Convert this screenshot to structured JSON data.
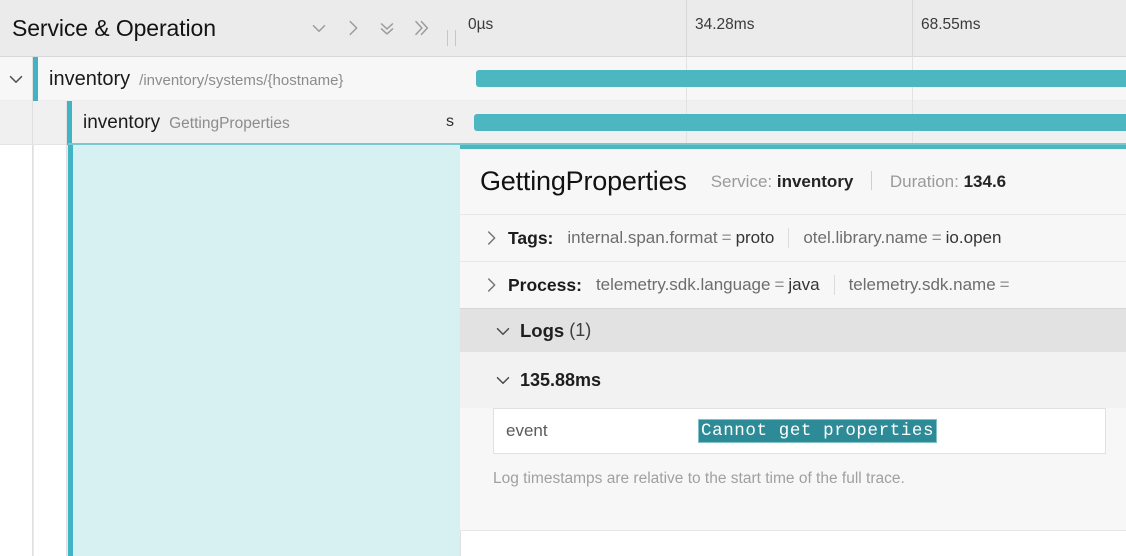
{
  "header": {
    "title": "Service & Operation",
    "icons": [
      {
        "name": "chevron-down-icon"
      },
      {
        "name": "chevron-right-icon"
      },
      {
        "name": "double-chevron-down-icon"
      },
      {
        "name": "double-chevron-right-icon"
      }
    ],
    "ticks": [
      "0µs",
      "34.28ms",
      "68.55ms"
    ]
  },
  "spans": [
    {
      "service": "inventory",
      "operation": "/inventory/systems/{hostname}",
      "expanded": true,
      "bar": {
        "left_pct": 2.4,
        "width_pct": 100
      },
      "duration_clipped": ""
    },
    {
      "service": "inventory",
      "operation": "GettingProperties",
      "expanded": false,
      "bar": {
        "left_pct": 4.7,
        "width_pct": 100
      },
      "duration_clipped": "s"
    }
  ],
  "detail": {
    "title": "GettingProperties",
    "service_label": "Service:",
    "service_value": "inventory",
    "duration_label": "Duration:",
    "duration_value": "134.6",
    "tags": {
      "label": "Tags:",
      "items": [
        {
          "key": "internal.span.format",
          "value": "proto"
        },
        {
          "key": "otel.library.name",
          "value": "io.open"
        }
      ]
    },
    "process": {
      "label": "Process:",
      "items": [
        {
          "key": "telemetry.sdk.language",
          "value": "java"
        },
        {
          "key": "telemetry.sdk.name",
          "value": ""
        }
      ]
    },
    "logs": {
      "title": "Logs",
      "count": "(1)",
      "timestamp": "135.88ms",
      "rows": [
        {
          "key": "event",
          "value": "Cannot get properties"
        }
      ],
      "note": "Log timestamps are relative to the start time of the full trace."
    }
  },
  "colors": {
    "teal": "#4cb6c1",
    "teal_accent": "#40b4c4",
    "cyan_bg": "#d7f0f2",
    "selection": "#2c8b96"
  }
}
